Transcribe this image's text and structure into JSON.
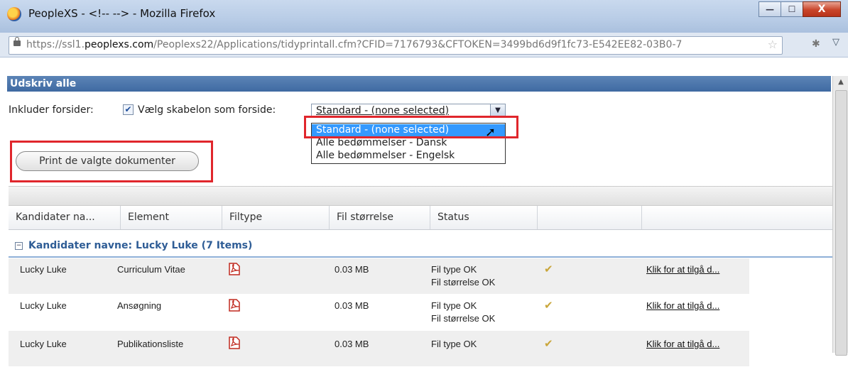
{
  "window": {
    "title": "PeopleXS - <!-- --> - Mozilla Firefox",
    "minimize": "—",
    "maximize": "☐",
    "close": "X"
  },
  "url": {
    "prefix": "https://ssl1.",
    "host": "peoplexs.com",
    "path": "/Peoplexs22/Applications/tidyprintall.cfm?CFID=7176793&CFTOKEN=3499bd6d9f1fc73-E542EE82-03B0-7"
  },
  "panel": {
    "title": "Udskriv alle"
  },
  "options": {
    "include_label": "Inkluder forsider:",
    "include_checked": "✔",
    "template_label": "Vælg skabelon som forside:",
    "selected_template": "Standard - (none selected)",
    "template_options": [
      "Standard - (none selected)",
      "Alle bedømmelser - Dansk",
      "Alle bedømmelser - Engelsk"
    ]
  },
  "print_button": "Print de valgte dokumenter",
  "grid": {
    "columns": [
      "Kandidater na...",
      "Element",
      "Filtype",
      "Fil størrelse",
      "Status",
      "",
      ""
    ],
    "group_toggle": "−",
    "group_label": "Kandidater navne: Lucky Luke (7 Items)",
    "rows": [
      {
        "name": "Lucky Luke",
        "element": "Curriculum Vitae",
        "size": "0.03 MB",
        "status1": "Fil type OK",
        "status2": "Fil størrelse OK",
        "link": "Klik for at tilgå d..."
      },
      {
        "name": "Lucky Luke",
        "element": "Ansøgning",
        "size": "0.03 MB",
        "status1": "Fil type OK",
        "status2": "Fil størrelse OK",
        "link": "Klik for at tilgå d..."
      },
      {
        "name": "Lucky Luke",
        "element": "Publikationsliste",
        "size": "0.03 MB",
        "status1": "Fil type OK",
        "status2": "",
        "link": "Klik for at tilgå d..."
      }
    ]
  },
  "colors": {
    "header_blue": "#3f6aa2",
    "highlight_red": "#e0262c",
    "selection_blue": "#3399ff"
  }
}
